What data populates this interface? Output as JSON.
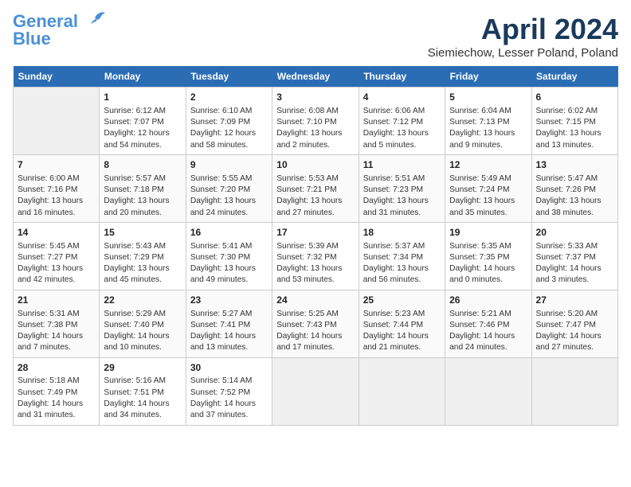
{
  "logo": {
    "line1": "General",
    "line2": "Blue"
  },
  "title": "April 2024",
  "location": "Siemiechow, Lesser Poland, Poland",
  "days_header": [
    "Sunday",
    "Monday",
    "Tuesday",
    "Wednesday",
    "Thursday",
    "Friday",
    "Saturday"
  ],
  "weeks": [
    [
      {
        "day": "",
        "info": ""
      },
      {
        "day": "1",
        "info": "Sunrise: 6:12 AM\nSunset: 7:07 PM\nDaylight: 12 hours\nand 54 minutes."
      },
      {
        "day": "2",
        "info": "Sunrise: 6:10 AM\nSunset: 7:09 PM\nDaylight: 12 hours\nand 58 minutes."
      },
      {
        "day": "3",
        "info": "Sunrise: 6:08 AM\nSunset: 7:10 PM\nDaylight: 13 hours\nand 2 minutes."
      },
      {
        "day": "4",
        "info": "Sunrise: 6:06 AM\nSunset: 7:12 PM\nDaylight: 13 hours\nand 5 minutes."
      },
      {
        "day": "5",
        "info": "Sunrise: 6:04 AM\nSunset: 7:13 PM\nDaylight: 13 hours\nand 9 minutes."
      },
      {
        "day": "6",
        "info": "Sunrise: 6:02 AM\nSunset: 7:15 PM\nDaylight: 13 hours\nand 13 minutes."
      }
    ],
    [
      {
        "day": "7",
        "info": "Sunrise: 6:00 AM\nSunset: 7:16 PM\nDaylight: 13 hours\nand 16 minutes."
      },
      {
        "day": "8",
        "info": "Sunrise: 5:57 AM\nSunset: 7:18 PM\nDaylight: 13 hours\nand 20 minutes."
      },
      {
        "day": "9",
        "info": "Sunrise: 5:55 AM\nSunset: 7:20 PM\nDaylight: 13 hours\nand 24 minutes."
      },
      {
        "day": "10",
        "info": "Sunrise: 5:53 AM\nSunset: 7:21 PM\nDaylight: 13 hours\nand 27 minutes."
      },
      {
        "day": "11",
        "info": "Sunrise: 5:51 AM\nSunset: 7:23 PM\nDaylight: 13 hours\nand 31 minutes."
      },
      {
        "day": "12",
        "info": "Sunrise: 5:49 AM\nSunset: 7:24 PM\nDaylight: 13 hours\nand 35 minutes."
      },
      {
        "day": "13",
        "info": "Sunrise: 5:47 AM\nSunset: 7:26 PM\nDaylight: 13 hours\nand 38 minutes."
      }
    ],
    [
      {
        "day": "14",
        "info": "Sunrise: 5:45 AM\nSunset: 7:27 PM\nDaylight: 13 hours\nand 42 minutes."
      },
      {
        "day": "15",
        "info": "Sunrise: 5:43 AM\nSunset: 7:29 PM\nDaylight: 13 hours\nand 45 minutes."
      },
      {
        "day": "16",
        "info": "Sunrise: 5:41 AM\nSunset: 7:30 PM\nDaylight: 13 hours\nand 49 minutes."
      },
      {
        "day": "17",
        "info": "Sunrise: 5:39 AM\nSunset: 7:32 PM\nDaylight: 13 hours\nand 53 minutes."
      },
      {
        "day": "18",
        "info": "Sunrise: 5:37 AM\nSunset: 7:34 PM\nDaylight: 13 hours\nand 56 minutes."
      },
      {
        "day": "19",
        "info": "Sunrise: 5:35 AM\nSunset: 7:35 PM\nDaylight: 14 hours\nand 0 minutes."
      },
      {
        "day": "20",
        "info": "Sunrise: 5:33 AM\nSunset: 7:37 PM\nDaylight: 14 hours\nand 3 minutes."
      }
    ],
    [
      {
        "day": "21",
        "info": "Sunrise: 5:31 AM\nSunset: 7:38 PM\nDaylight: 14 hours\nand 7 minutes."
      },
      {
        "day": "22",
        "info": "Sunrise: 5:29 AM\nSunset: 7:40 PM\nDaylight: 14 hours\nand 10 minutes."
      },
      {
        "day": "23",
        "info": "Sunrise: 5:27 AM\nSunset: 7:41 PM\nDaylight: 14 hours\nand 13 minutes."
      },
      {
        "day": "24",
        "info": "Sunrise: 5:25 AM\nSunset: 7:43 PM\nDaylight: 14 hours\nand 17 minutes."
      },
      {
        "day": "25",
        "info": "Sunrise: 5:23 AM\nSunset: 7:44 PM\nDaylight: 14 hours\nand 21 minutes."
      },
      {
        "day": "26",
        "info": "Sunrise: 5:21 AM\nSunset: 7:46 PM\nDaylight: 14 hours\nand 24 minutes."
      },
      {
        "day": "27",
        "info": "Sunrise: 5:20 AM\nSunset: 7:47 PM\nDaylight: 14 hours\nand 27 minutes."
      }
    ],
    [
      {
        "day": "28",
        "info": "Sunrise: 5:18 AM\nSunset: 7:49 PM\nDaylight: 14 hours\nand 31 minutes."
      },
      {
        "day": "29",
        "info": "Sunrise: 5:16 AM\nSunset: 7:51 PM\nDaylight: 14 hours\nand 34 minutes."
      },
      {
        "day": "30",
        "info": "Sunrise: 5:14 AM\nSunset: 7:52 PM\nDaylight: 14 hours\nand 37 minutes."
      },
      {
        "day": "",
        "info": ""
      },
      {
        "day": "",
        "info": ""
      },
      {
        "day": "",
        "info": ""
      },
      {
        "day": "",
        "info": ""
      }
    ]
  ]
}
